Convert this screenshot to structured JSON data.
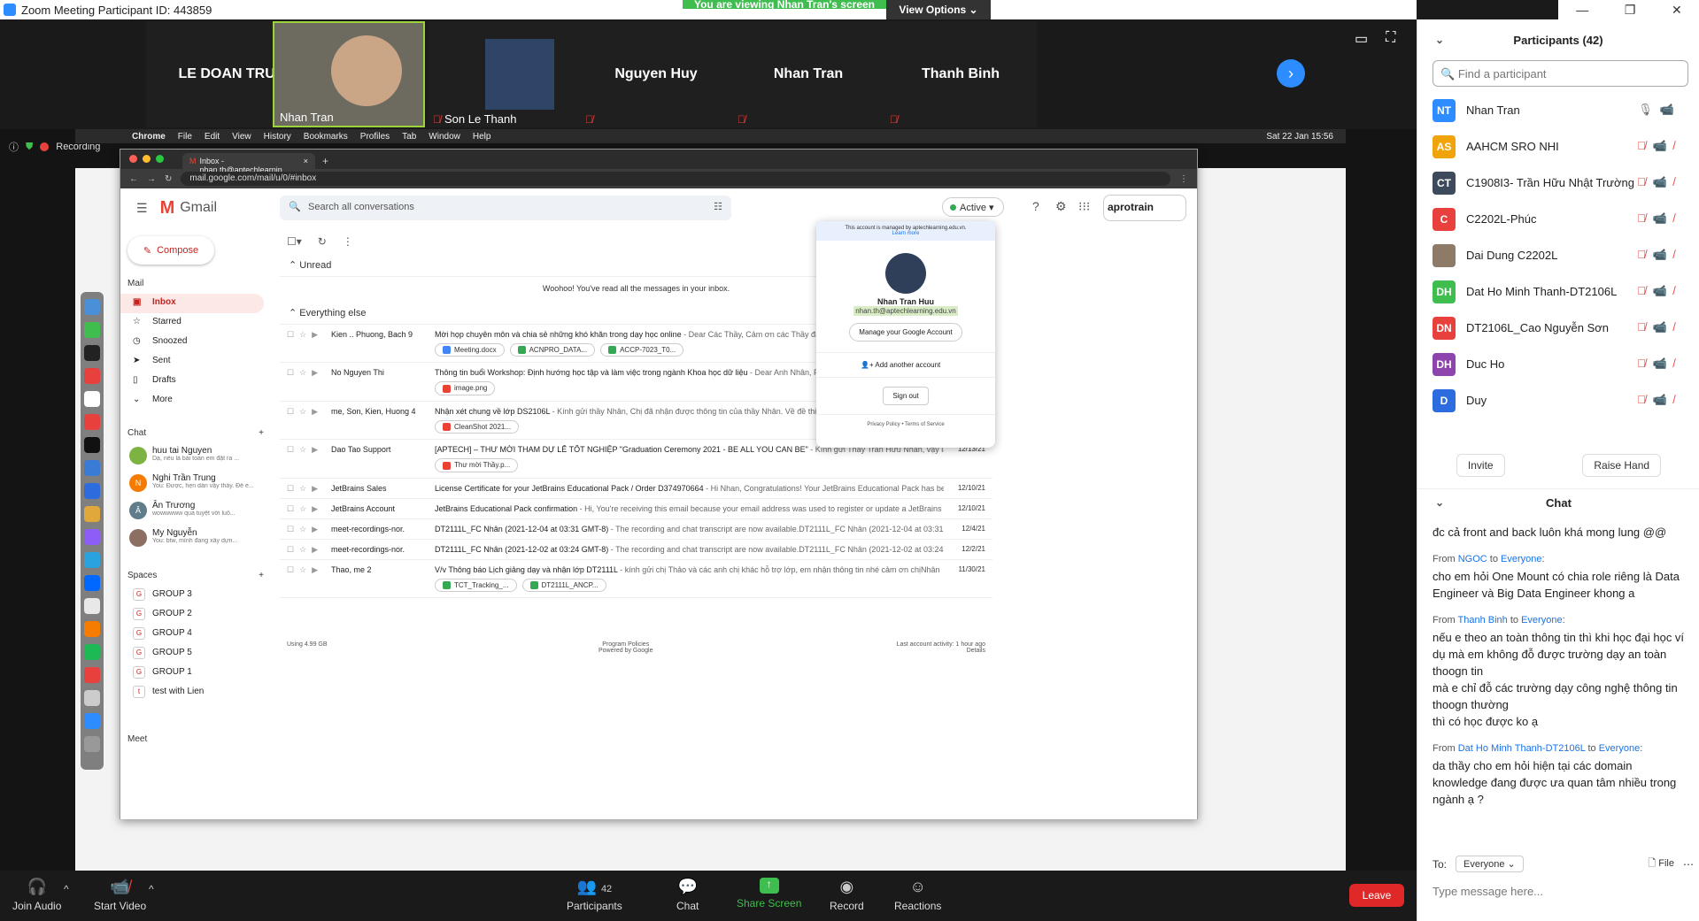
{
  "zoom": {
    "title": "Zoom Meeting Participant ID: 443859",
    "viewing_banner": "You are viewing Nhan Tran's screen",
    "view_options": "View Options",
    "recording": "Recording"
  },
  "video_strip": [
    {
      "name": "LE DOAN TRUO...",
      "type": "name"
    },
    {
      "name": "Nhan Tran",
      "type": "video"
    },
    {
      "name": "Son Le Thanh",
      "type": "photo"
    },
    {
      "name": "Nguyen Huy",
      "type": "name"
    },
    {
      "name": "Nhan Tran",
      "type": "name"
    },
    {
      "name": "Thanh Binh",
      "type": "name"
    }
  ],
  "mac_menu": [
    "Chrome",
    "File",
    "Edit",
    "View",
    "History",
    "Bookmarks",
    "Profiles",
    "Tab",
    "Window",
    "Help"
  ],
  "mac_clock": "Sat 22 Jan  15:56",
  "browser": {
    "tab_title": "Inbox - nhan.th@aptechlearnin",
    "url": "mail.google.com/mail/u/0/#inbox"
  },
  "gmail": {
    "logo": "Gmail",
    "search_placeholder": "Search all conversations",
    "status": "Active",
    "brand": "aprotrain",
    "compose": "Compose",
    "mail_section": "Mail",
    "nav": [
      {
        "label": "Inbox",
        "icon": "inbox-icon"
      },
      {
        "label": "Starred",
        "icon": "star-icon"
      },
      {
        "label": "Snoozed",
        "icon": "clock-icon"
      },
      {
        "label": "Sent",
        "icon": "send-icon"
      },
      {
        "label": "Drafts",
        "icon": "draft-icon"
      },
      {
        "label": "More",
        "icon": "chevron-down-icon"
      }
    ],
    "chat_section": "Chat",
    "chats": [
      {
        "name": "huu tai Nguyen",
        "preview": "Dạ, nếu là bài toán em đặt ra ..."
      },
      {
        "name": "Nghi Trần Trung",
        "preview": "You: Được, hẹn dần vậy thầy. Để e..."
      },
      {
        "name": "Ân Trương",
        "preview": "wowwwww quá tuyệt vời luô..."
      },
      {
        "name": "My Nguyễn",
        "preview": "You: btw, mình đang xây dựn..."
      }
    ],
    "spaces_section": "Spaces",
    "spaces": [
      {
        "letter": "G",
        "name": "GROUP 3"
      },
      {
        "letter": "G",
        "name": "GROUP 2"
      },
      {
        "letter": "G",
        "name": "GROUP 4"
      },
      {
        "letter": "G",
        "name": "GROUP 5"
      },
      {
        "letter": "G",
        "name": "GROUP 1"
      },
      {
        "letter": "t",
        "name": "test with Lien"
      }
    ],
    "meet_section": "Meet",
    "unread_header": "Unread",
    "unread_empty": "Woohoo! You've read all the messages in your inbox.",
    "else_header": "Everything else",
    "emails": [
      {
        "from": "Kien .. Phuong, Bach 9",
        "subject": "Mời họp chuyên môn và chia sẻ những khó khăn trong dạy học online",
        "snippet": " - Dear Các Thầy, Cảm ơn các Thầy đã tham gia họp và đó",
        "date": "",
        "chips": [
          {
            "label": "Meeting.docx",
            "color": "#4285f4"
          },
          {
            "label": "ACNPRO_DATA...",
            "color": "#34a853"
          },
          {
            "label": "ACCP-7023_T0...",
            "color": "#34a853"
          }
        ]
      },
      {
        "from": "No Nguyen Thi",
        "subject": "Thông tin buổi Workshop: Định hướng học tập và làm việc trong ngành Khoa học dữ liệu",
        "snippet": " - Dear Anh Nhân, Phòng đào tạo Aptech",
        "date": "",
        "chips": [
          {
            "label": "image.png",
            "color": "#ea4335"
          }
        ]
      },
      {
        "from": "me, Son, Kien, Huong 4",
        "subject": "Nhận xét chung về lớp DS2106L",
        "snippet": " - Kính gửi thầy Nhân, Chị đã nhận được thông tin của thầy Nhân. Về đề thi có sai sót, chưa sát v",
        "date": "",
        "chips": [
          {
            "label": "CleanShot 2021...",
            "color": "#ea4335"
          }
        ]
      },
      {
        "from": "Dao Tao Support",
        "subject": "[APTECH] – THƯ MỜI THAM DỰ LỄ TỐT NGHIỆP \"Graduation Ceremony 2021 - BE ALL YOU CAN BE\"",
        "snippet": " - Kính gửi Thầy Trần Hữu Nhân, vậy là sau một chặng...",
        "date": "12/13/21",
        "chips": [
          {
            "label": "Thư mời Thầy.p...",
            "color": "#ea4335"
          }
        ]
      },
      {
        "from": "JetBrains Sales",
        "subject": "License Certificate for your JetBrains Educational Pack / Order D374970664",
        "snippet": " - Hi Nhan, Congratulations! Your JetBrains Educational Pack has been confir...",
        "date": "12/10/21",
        "chips": []
      },
      {
        "from": "JetBrains Account",
        "subject": "JetBrains Educational Pack confirmation",
        "snippet": " - Hi, You're receiving this email because your email address was used to register or update a JetBrains Education...",
        "date": "12/10/21",
        "chips": []
      },
      {
        "from": "meet-recordings-nor.",
        "subject": "DT2111L_FC Nhân (2021-12-04 at 03:31 GMT-8)",
        "snippet": " - The recording and chat transcript are now available.DT2111L_FC Nhân (2021-12-04 at 03:31 GMT-8)Ope...",
        "date": "12/4/21",
        "chips": []
      },
      {
        "from": "meet-recordings-nor.",
        "subject": "DT2111L_FC Nhân (2021-12-02 at 03:24 GMT-8)",
        "snippet": " - The recording and chat transcript are now available.DT2111L_FC Nhân (2021-12-02 at 03:24 GMT-8)Ope...",
        "date": "12/2/21",
        "chips": []
      },
      {
        "from": "Thao, me 2",
        "subject": "V/v Thông báo Lịch giảng dạy và nhận lớp DT2111L",
        "snippet": " - kính gửi chị Thảo và các anh chị khác hỗ trợ lớp, em nhận thông tin nhé cảm ơn chịNhân",
        "date": "11/30/21",
        "chips": [
          {
            "label": "TCT_Tracking_...",
            "color": "#34a853"
          },
          {
            "label": "DT2111L_ANCP...",
            "color": "#34a853"
          }
        ]
      }
    ],
    "footer": {
      "storage": "Using 4.99 GB",
      "policies": "Program Policies",
      "powered": "Powered by Google",
      "activity": "Last account activity: 1 hour ago",
      "details": "Details"
    },
    "account_popup": {
      "managed": "This account is managed by aptechlearning.edu.vn.",
      "learn_more": "Learn more",
      "name": "Nhan Tran Huu",
      "email": "nhan.th@aptechlearning.edu.vn",
      "manage": "Manage your Google Account",
      "add": "Add another account",
      "signout": "Sign out",
      "privacy": "Privacy Policy",
      "terms": "Terms of Service"
    }
  },
  "toolbar": {
    "join_audio": "Join Audio",
    "start_video": "Start Video",
    "participants": "Participants",
    "participants_count": "42",
    "chat": "Chat",
    "share_screen": "Share Screen",
    "record": "Record",
    "reactions": "Reactions",
    "leave": "Leave"
  },
  "participants_panel": {
    "title": "Participants (42)",
    "search_placeholder": "Find a participant",
    "list": [
      {
        "initials": "NT",
        "name": "Nhan Tran",
        "color": "#2d8cff",
        "muted": false
      },
      {
        "initials": "AS",
        "name": "AAHCM SRO NHI",
        "color": "#f0a30a",
        "muted": true
      },
      {
        "initials": "CT",
        "name": "C1908I3- Trần Hữu Nhật Trường",
        "color": "#3c4a5c",
        "muted": true
      },
      {
        "initials": "C",
        "name": "C2202L-Phúc",
        "color": "#e8413d",
        "muted": true
      },
      {
        "initials": "",
        "name": "Dai Dung C2202L",
        "color": "#8d7b68",
        "muted": true
      },
      {
        "initials": "DH",
        "name": "Dat Ho Minh Thanh-DT2106L",
        "color": "#3fbe4f",
        "muted": true
      },
      {
        "initials": "DN",
        "name": "DT2106L_Cao Nguyễn Sơn",
        "color": "#e8413d",
        "muted": true
      },
      {
        "initials": "DH",
        "name": "Duc Ho",
        "color": "#8e44ad",
        "muted": true
      },
      {
        "initials": "D",
        "name": "Duy",
        "color": "#2d6cdf",
        "muted": true
      }
    ],
    "invite": "Invite",
    "raise_hand": "Raise Hand"
  },
  "chat_panel": {
    "title": "Chat",
    "messages": [
      {
        "from": "",
        "to": "",
        "text": "đc cả front and back luôn khá mong lung @@"
      },
      {
        "from": "NGOC",
        "to": "Everyone",
        "text": "cho em hỏi One Mount có chia role riêng là Data Engineer và Big Data Engineer khong a"
      },
      {
        "from": "Thanh Binh",
        "to": "Everyone",
        "text": "nếu e theo an toàn thông tin thì khi học đại học ví dụ mà em không đỗ được trường dạy an toàn thoogn tin\nmà e chỉ đỗ các trường dạy công nghệ thông tin thoogn thường\nthì có học được ko ạ"
      },
      {
        "from": "Dat Ho Minh Thanh-DT2106L",
        "to": "Everyone",
        "text": "da thầy cho em hỏi hiện tại các domain knowledge đang được ưa quan tâm nhiều trong ngành ạ ?"
      }
    ],
    "to_label": "To:",
    "to_value": "Everyone",
    "file": "File",
    "placeholder": "Type message here..."
  }
}
